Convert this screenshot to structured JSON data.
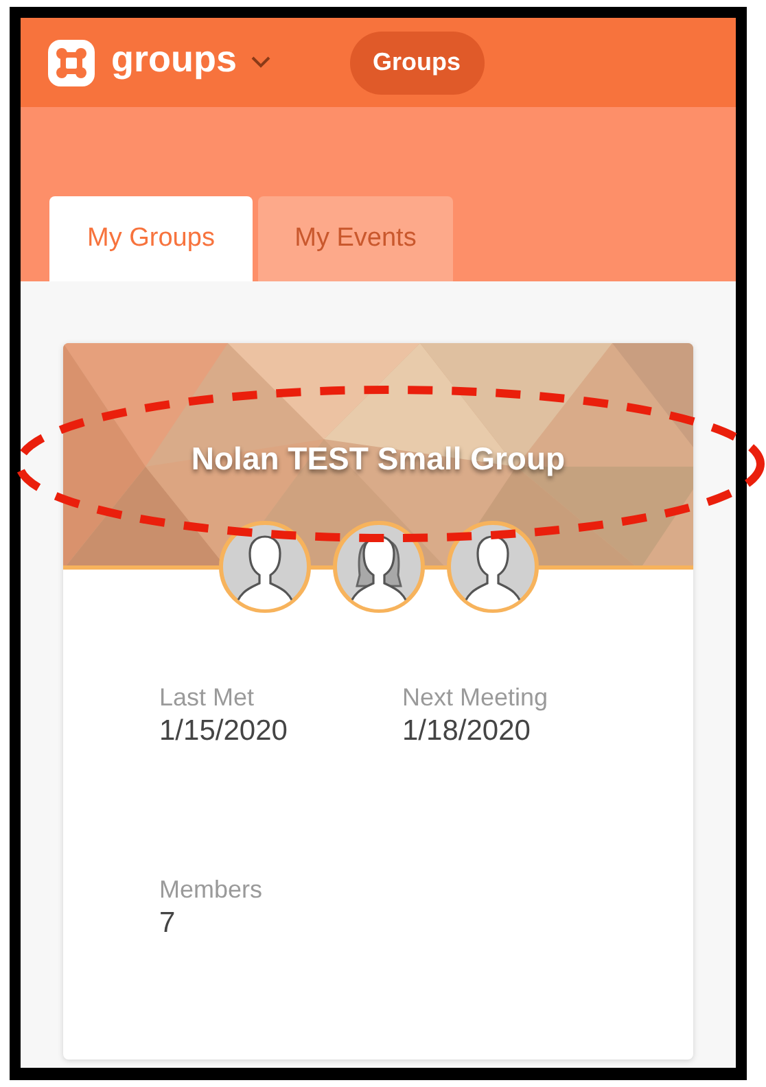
{
  "header": {
    "app_name": "groups",
    "nav_button": "Groups"
  },
  "tabs": [
    {
      "label": "My Groups",
      "selected": true
    },
    {
      "label": "My Events",
      "selected": false
    }
  ],
  "group_card": {
    "title": "Nolan TEST Small Group",
    "avatars": [
      {
        "kind": "short-hair"
      },
      {
        "kind": "long-hair"
      },
      {
        "kind": "short-hair"
      }
    ],
    "details": [
      {
        "label": "Last Met",
        "value": "1/15/2020"
      },
      {
        "label": "Next Meeting",
        "value": "1/18/2020"
      },
      {
        "label": "Members",
        "value": "7"
      }
    ]
  }
}
